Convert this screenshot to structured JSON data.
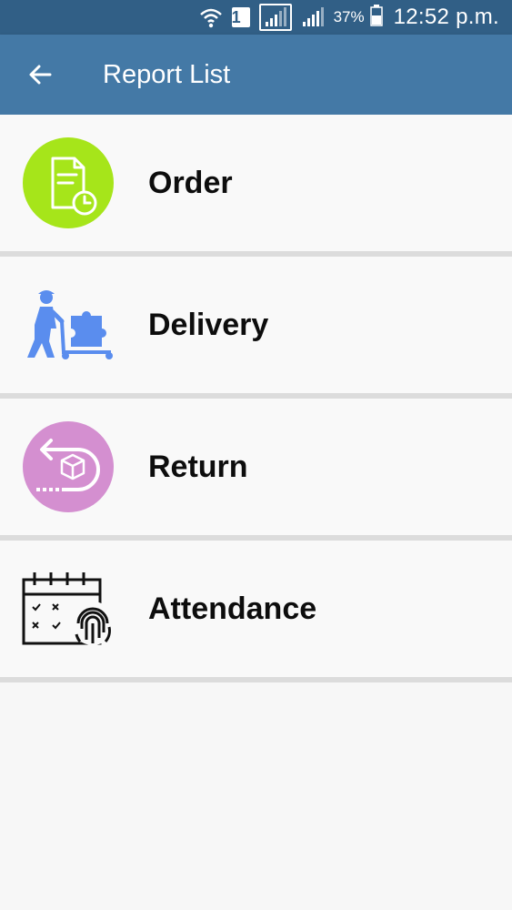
{
  "status_bar": {
    "sim_slot": "1",
    "battery": "37%",
    "time": "12:52 p.m.",
    "icons": [
      "wifi-icon",
      "sim-icon",
      "signal-icon",
      "signal-icon",
      "battery-icon"
    ]
  },
  "app_bar": {
    "title": "Report List",
    "back_icon": "arrow-left-icon",
    "background": "#4479a6"
  },
  "report_list": [
    {
      "label": "Order",
      "icon": "order-document-clock-icon",
      "icon_color": "#a6e51a"
    },
    {
      "label": "Delivery",
      "icon": "delivery-pallet-jack-icon",
      "icon_color": "#5a8dee"
    },
    {
      "label": "Return",
      "icon": "return-box-arrow-icon",
      "icon_color": "#d48fd0"
    },
    {
      "label": "Attendance",
      "icon": "attendance-calendar-fingerprint-icon",
      "icon_color": "#111111"
    }
  ]
}
